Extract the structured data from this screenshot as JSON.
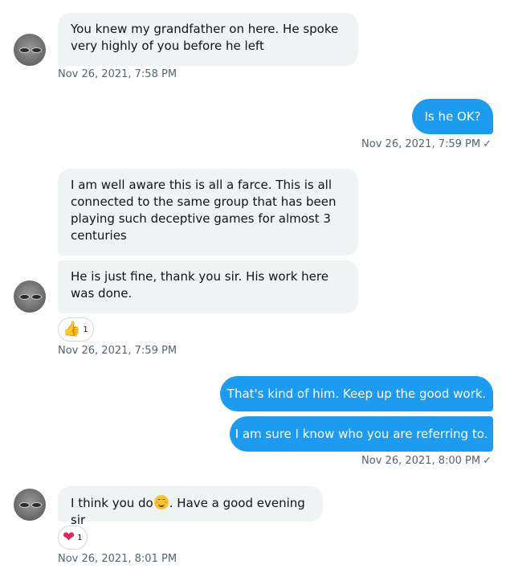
{
  "messages": [
    {
      "text": "You knew my grandfather on here. He spoke very highly of you before he left"
    },
    {
      "text": "Is he OK?"
    },
    {
      "text": "I am well aware this is all a farce. This is all connected to the same group that has been playing such deceptive games for almost 3 centuries"
    },
    {
      "text": "He is just fine, thank you sir. His work here was done."
    },
    {
      "text": "That's kind of him. Keep up the good work."
    },
    {
      "text": "I am sure I know who you are referring to."
    },
    {
      "text_before": "I think you do",
      "emoji": "smiling-face-icon",
      "text_after": ". Have a good evening sir"
    }
  ],
  "timestamps": [
    "Nov 26, 2021, 7:58 PM",
    "Nov 26, 2021, 7:59 PM",
    "Nov 26, 2021, 7:59 PM",
    "Nov 26, 2021, 8:00 PM",
    "Nov 26, 2021, 8:01 PM"
  ],
  "read_mark": "✓",
  "reactions": [
    {
      "emoji": "👍",
      "count": "1"
    },
    {
      "emoji": "❤",
      "count": "1"
    }
  ],
  "colors": {
    "outgoing": "#1d9bf0",
    "incoming": "#eff3f4",
    "heart": "#e0245e"
  }
}
